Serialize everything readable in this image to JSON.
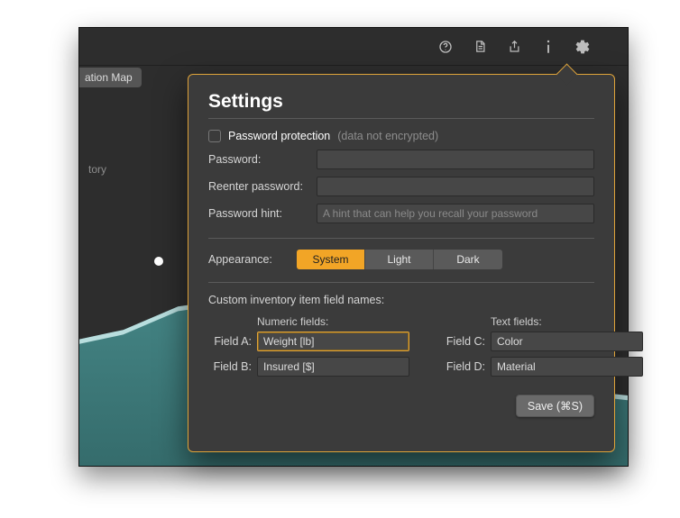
{
  "toolbar": {
    "icons": [
      "help",
      "document",
      "share",
      "info",
      "settings"
    ]
  },
  "tab": {
    "label": "ation Map"
  },
  "graph": {
    "y_label_fragment": "tory"
  },
  "popover": {
    "title": "Settings",
    "password_protection": {
      "checkbox_label": "Password protection",
      "note": "(data not encrypted)",
      "checked": false
    },
    "password_label": "Password:",
    "reenter_label": "Reenter password:",
    "hint_label": "Password hint:",
    "hint_placeholder": "A hint that can help you recall your password",
    "appearance_label": "Appearance:",
    "appearance_options": [
      "System",
      "Light",
      "Dark"
    ],
    "appearance_selected": "System",
    "custom_fields_label": "Custom inventory item field names:",
    "numeric_header": "Numeric fields:",
    "text_header": "Text fields:",
    "fields": {
      "a": {
        "label": "Field A:",
        "value": "Weight [lb]"
      },
      "b": {
        "label": "Field B:",
        "value": "Insured [$]"
      },
      "c": {
        "label": "Field C:",
        "value": "Color"
      },
      "d": {
        "label": "Field D:",
        "value": "Material"
      }
    },
    "save_label": "Save (⌘S)"
  }
}
